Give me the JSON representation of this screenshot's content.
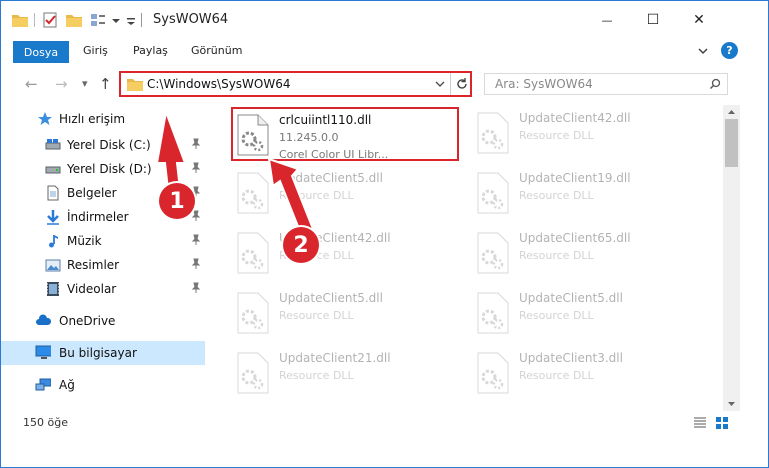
{
  "window": {
    "title": "SysWOW64",
    "min_glyph": "—",
    "max_glyph": "☐",
    "close_glyph": "✕"
  },
  "ribbon": {
    "tabs": [
      "Dosya",
      "Giriş",
      "Paylaş",
      "Görünüm"
    ],
    "help_glyph": "?"
  },
  "nav": {
    "back_glyph": "←",
    "forward_glyph": "→",
    "recent_glyph": "▾",
    "up_glyph": "↑",
    "address": "C:\\Windows\\SysWOW64",
    "search_placeholder": "Ara: SysWOW64"
  },
  "sidebar": {
    "quick_access": "Hızlı erişim",
    "items": [
      {
        "label": "Yerel Disk (C:)",
        "icon": "drive-icon"
      },
      {
        "label": "Yerel Disk (D:)",
        "icon": "drive-icon"
      },
      {
        "label": "Belgeler",
        "icon": "documents-icon"
      },
      {
        "label": "İndirmeler",
        "icon": "downloads-icon"
      },
      {
        "label": "Müzik",
        "icon": "music-icon"
      },
      {
        "label": "Resimler",
        "icon": "pictures-icon"
      },
      {
        "label": "Videolar",
        "icon": "videos-icon"
      }
    ],
    "onedrive": "OneDrive",
    "this_pc": "Bu bilgisayar",
    "network": "Ağ"
  },
  "files": {
    "highlighted": {
      "name": "crlcuiintl110.dll",
      "version": "11.245.0.0",
      "description": "Corel Color UI Libr..."
    },
    "faded": [
      {
        "name": "UpdateClient42.dll",
        "sub": "Resource DLL"
      },
      {
        "name": "UpdateClient5.dll",
        "sub": "Resource DLL"
      },
      {
        "name": "UpdateClient19.dll",
        "sub": "Resource DLL"
      },
      {
        "name": "UpdateClient42.dll",
        "sub": "Resource DLL"
      },
      {
        "name": "UpdateClient65.dll",
        "sub": "Resource DLL"
      },
      {
        "name": "UpdateClient5.dll",
        "sub": "Resource DLL"
      },
      {
        "name": "UpdateClient5.dll",
        "sub": "Resource DLL"
      },
      {
        "name": "UpdateClient21.dll",
        "sub": "Resource DLL"
      },
      {
        "name": "UpdateClient3.dll",
        "sub": "Resource DLL"
      }
    ]
  },
  "status": {
    "count": "150 öğe"
  },
  "annotations": {
    "step1": "1",
    "step2": "2"
  },
  "colors": {
    "accent": "#1979ca",
    "highlight": "#d9262d",
    "selection": "#cce8ff"
  }
}
